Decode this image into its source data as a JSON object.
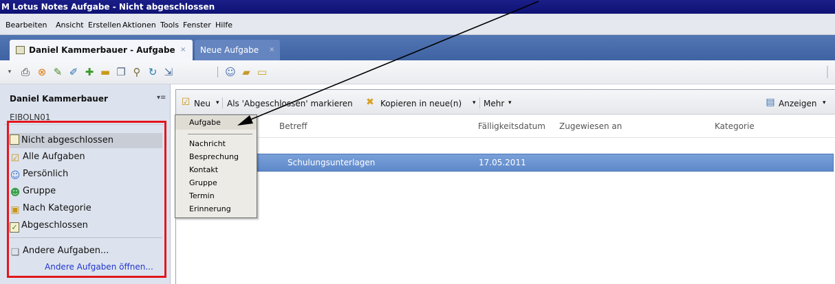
{
  "window": {
    "title": "M Lotus Notes Aufgabe - Nicht abgeschlossen"
  },
  "menu": [
    "Bearbeiten",
    "Ansicht",
    "Erstellen",
    "Aktionen",
    "Tools",
    "Fenster",
    "Hilfe"
  ],
  "tabs": [
    {
      "label": "Daniel Kammerbauer - Aufgabe",
      "close": "×"
    },
    {
      "label": "Neue Aufgabe",
      "close": "×"
    }
  ],
  "toolbar_icons": [
    "dropdown-icon",
    "print-icon",
    "stop-icon",
    "pen-icon",
    "pen-edit-icon",
    "add-icon",
    "remove-icon",
    "copy-icon",
    "find-icon",
    "refresh-icon",
    "move-icon",
    "users-icon",
    "folder-icon",
    "window-icon"
  ],
  "sidebar": {
    "owner": "Daniel Kammerbauer",
    "server": "EIBOLN01",
    "items": [
      {
        "label": "Nicht abgeschlossen",
        "icon": "task-incomplete-icon"
      },
      {
        "label": "Alle Aufgaben",
        "icon": "all-tasks-icon"
      },
      {
        "label": "Persönlich",
        "icon": "person-icon"
      },
      {
        "label": "Gruppe",
        "icon": "group-icon"
      },
      {
        "label": "Nach Kategorie",
        "icon": "category-icon"
      },
      {
        "label": "Abgeschlossen",
        "icon": "completed-icon"
      }
    ],
    "other": {
      "label": "Andere Aufgaben...",
      "icon": "other-tasks-icon"
    },
    "open_other_link": "Andere Aufgaben öffnen..."
  },
  "actionbar": {
    "new": "Neu",
    "mark_done": "Als 'Abgeschlossen' markieren",
    "copy_new": "Kopieren in neue(n)",
    "more": "Mehr",
    "display": "Anzeigen"
  },
  "columns": {
    "subject": "Betreff",
    "due": "Fälligkeitsdatum",
    "assigned": "Zugewiesen an",
    "category": "Kategorie"
  },
  "rows": [
    {
      "subject": "Schulungsunterlagen",
      "due": "17.05.2011",
      "assigned": "",
      "category": ""
    }
  ],
  "new_menu": {
    "top": "Aufgabe",
    "items": [
      "Nachricht",
      "Besprechung",
      "Kontakt",
      "Gruppe",
      "Termin",
      "Erinnerung"
    ]
  },
  "colors": {
    "titlebar": "#0f1374",
    "highlight_box": "#e3151d",
    "selected_row": "#5f89cb",
    "link": "#1f35d0"
  }
}
